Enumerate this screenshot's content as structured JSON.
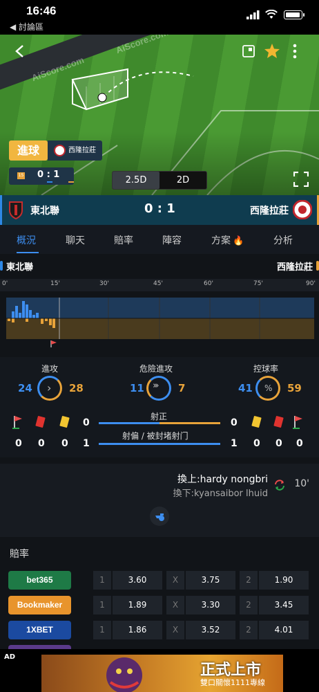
{
  "status_bar": {
    "time": "16:46",
    "back_label": "◀ 討論區"
  },
  "field": {
    "watermark": "AiScore.com",
    "event_label": "進球",
    "event_team": "西隆拉莊",
    "mini_score": "0 : 1",
    "mini_minute": "15",
    "view_toggle": [
      "2.5D",
      "2D"
    ],
    "active_view": "2D"
  },
  "scoreboard": {
    "home": "東北聯",
    "score": "0 : 1",
    "away": "西隆拉莊"
  },
  "tabs": [
    "概況",
    "聊天",
    "賠率",
    "陣容",
    "方案",
    "分析"
  ],
  "timeline": {
    "home": "東北聯",
    "away": "西隆拉莊",
    "ticks": [
      "0'",
      "15'",
      "30'",
      "45'",
      "60'",
      "75'",
      "90'"
    ]
  },
  "stats": {
    "attack": {
      "label": "進攻",
      "home": "24",
      "away": "28"
    },
    "danger": {
      "label": "危險進攻",
      "home": "11",
      "away": "7"
    },
    "possession": {
      "label": "控球率",
      "home": "41",
      "away": "59"
    },
    "on_target": {
      "label": "射正",
      "home": "0",
      "away": "0"
    },
    "off_target": {
      "label": "射偏 / 被封堵射门",
      "home": "1",
      "away": "1"
    },
    "home_cards": {
      "corners": "0",
      "red": "0",
      "yellow": "0"
    },
    "away_cards": {
      "yellow": "0",
      "red": "0",
      "corners": "0"
    }
  },
  "substitution": {
    "in": "換上:hardy nongbri",
    "out": "換下:kyansaibor lhuid",
    "minute": "10'"
  },
  "odds": {
    "title": "賠率",
    "rows": [
      {
        "book": "bet365",
        "k1": "1",
        "v1": "3.60",
        "kx": "X",
        "vx": "3.75",
        "k2": "2",
        "v2": "1.90",
        "color": "#1e7a46"
      },
      {
        "book": "Bookmaker",
        "k1": "1",
        "v1": "1.89",
        "kx": "X",
        "vx": "3.30",
        "k2": "2",
        "v2": "3.45",
        "color": "#e8942c"
      },
      {
        "book": "1XBET",
        "k1": "1",
        "v1": "1.86",
        "kx": "X",
        "vx": "3.52",
        "k2": "2",
        "v2": "4.01",
        "color": "#1b4aa0"
      }
    ]
  },
  "ad": {
    "tag": "AD",
    "headline": "正式上市",
    "subline": "雙口關懷1111專線"
  },
  "colors": {
    "home": "#2e88e6",
    "away": "#e8a33a",
    "accent": "#3d8ef0"
  }
}
